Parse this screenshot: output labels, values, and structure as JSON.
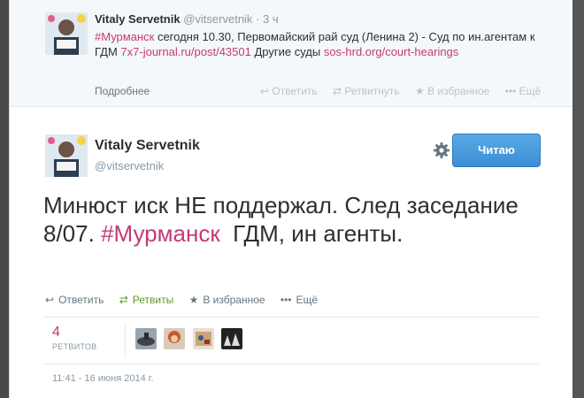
{
  "previous_tweet": {
    "name": "Vitaly Servetnik",
    "handle": "@vitservetnik",
    "separator": "·",
    "time": "3 ч",
    "hashtag": "#Мурманск",
    "text_part1": " сегодня 10.30, Первомайский рай суд (Ленина 2) - Суд по ин.агентам к ГДМ ",
    "link1": "7x7-journal.ru/post/43501",
    "text_part2": " Другие суды ",
    "link2": "sos-hrd.org/court-hearings",
    "more_label": "Подробнее",
    "actions": {
      "reply": "Ответить",
      "retweet": "Ретвитнуть",
      "favorite": "В избранное",
      "more": "Ещё"
    }
  },
  "main_tweet": {
    "name": "Vitaly Servetnik",
    "handle": "@vitservetnik",
    "follow_label": "Читаю",
    "text_part1": "Минюст иск НЕ поддержал. След заседание 8/07. ",
    "hashtag": "#Мурманск",
    "text_part2": "  ГДМ, ин агенты.",
    "actions": {
      "reply": "Ответить",
      "retweet": "Ретвиты",
      "favorite": "В избранное",
      "more": "Ещё"
    },
    "retweet_count": "4",
    "retweet_label": "РЕТВИТОВ",
    "timestamp": "11:41 - 16 июня 2014 г."
  },
  "colors": {
    "hashtag": "#c33a76",
    "follow_button": "#3b8ed5",
    "retweet_active": "#609928"
  },
  "icons": [
    "reply-icon",
    "retweet-icon",
    "star-icon",
    "ellipsis-icon",
    "gear-icon"
  ]
}
